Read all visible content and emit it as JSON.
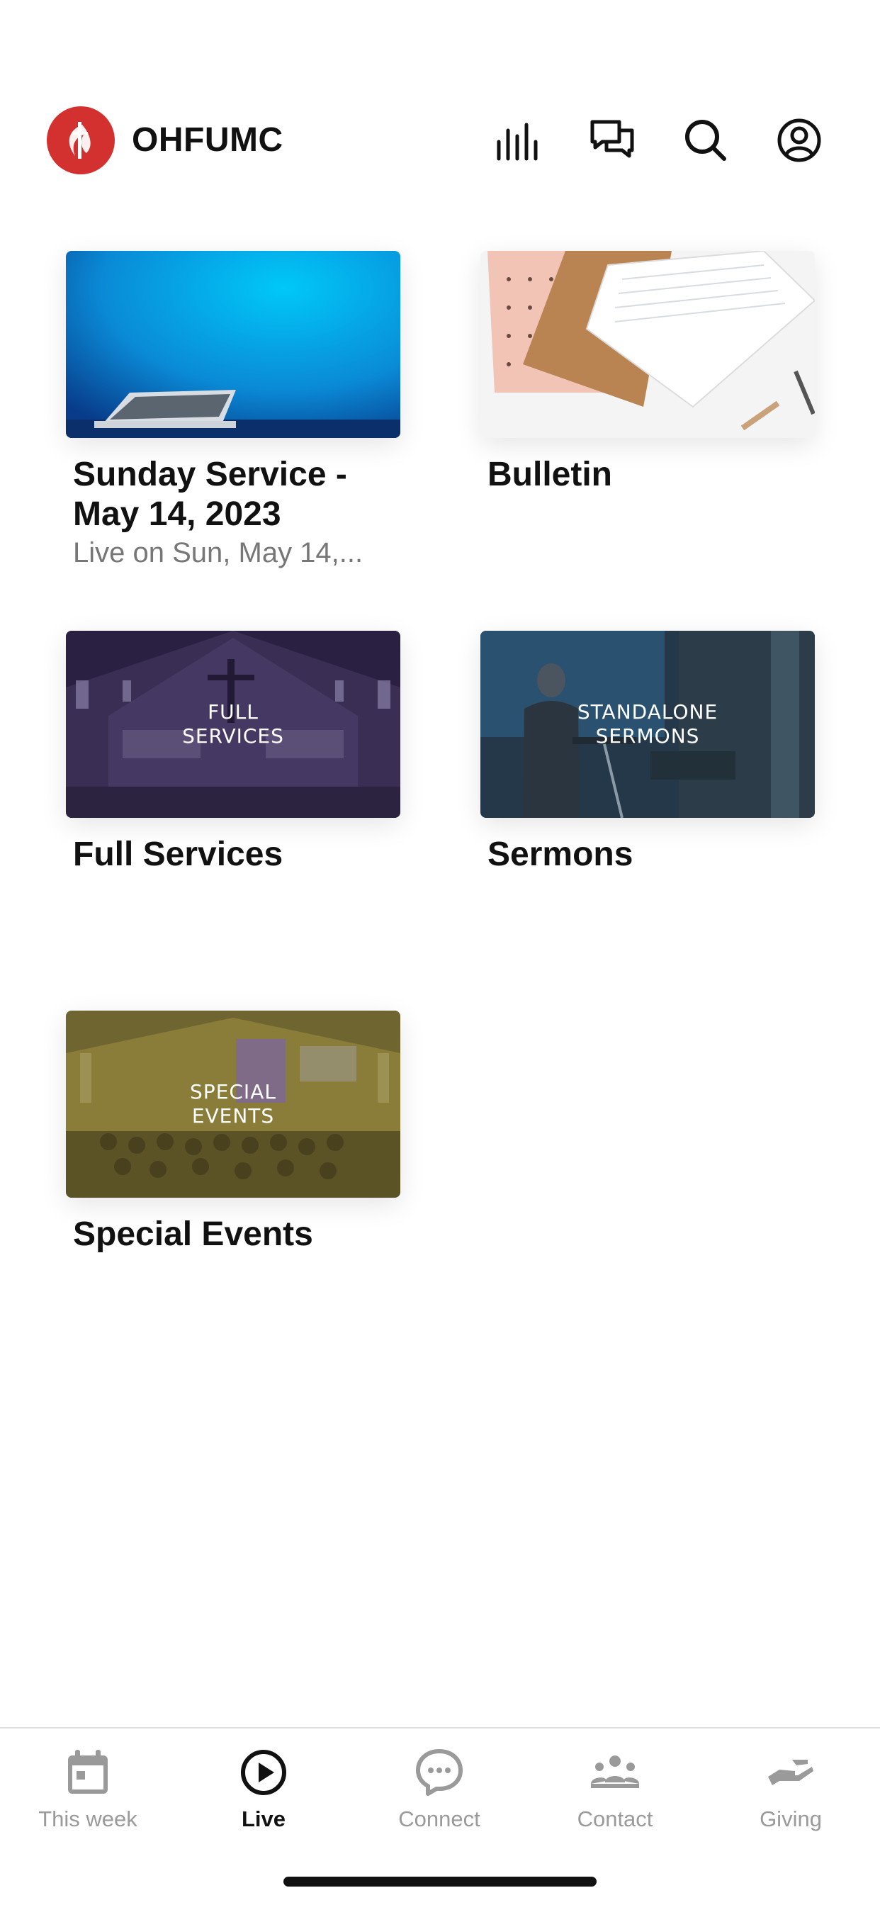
{
  "header": {
    "title": "OHFUMC",
    "logo_color": "#d3312f",
    "icons": [
      "equalizer-icon",
      "chat-icon",
      "search-icon",
      "account-icon"
    ]
  },
  "cards": [
    {
      "title": "Sunday Service -\nMay 14, 2023",
      "subtitle": "Live on Sun, May 14,...",
      "overlay": ""
    },
    {
      "title": "Bulletin",
      "subtitle": "",
      "overlay": ""
    },
    {
      "title": "Full Services",
      "subtitle": "",
      "overlay": "FULL\nSERVICES"
    },
    {
      "title": "Sermons",
      "subtitle": "",
      "overlay": "STANDALONE\nSERMONS"
    },
    {
      "title": "Special Events",
      "subtitle": "",
      "overlay": "SPECIAL\nEVENTS"
    }
  ],
  "tabbar": {
    "tabs": [
      {
        "label": "This week",
        "icon": "calendar-icon",
        "active": false
      },
      {
        "label": "Live",
        "icon": "play-circle-icon",
        "active": true
      },
      {
        "label": "Connect",
        "icon": "chat-bubble-icon",
        "active": false
      },
      {
        "label": "Contact",
        "icon": "group-icon",
        "active": false
      },
      {
        "label": "Giving",
        "icon": "giving-hand-icon",
        "active": false
      }
    ]
  },
  "colors": {
    "accent": "#d3312f",
    "tab_inactive": "#9a9a9a",
    "tab_active": "#111111"
  }
}
